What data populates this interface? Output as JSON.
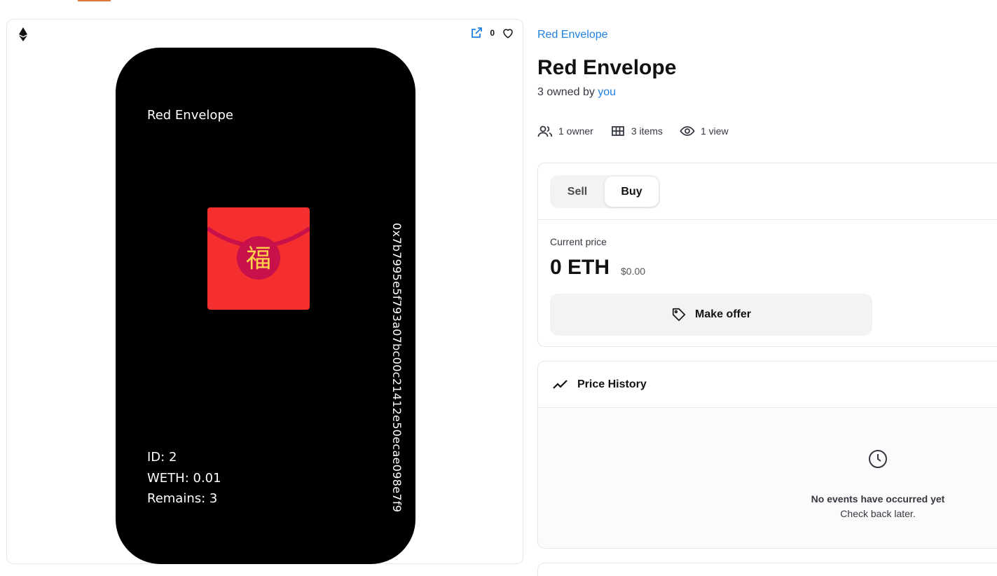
{
  "media": {
    "favorite_count": "0",
    "nft": {
      "title": "Red Envelope",
      "character": "福",
      "id_line": "ID: 2",
      "weth_line": "WETH: 0.01",
      "remains_line": "Remains: 3",
      "contract_address": "0x7b7995e5f793a07bc00c21412e50ecae098e7f9"
    }
  },
  "item": {
    "collection_name": "Red Envelope",
    "title": "Red Envelope",
    "owned_prefix": "3 owned by ",
    "owned_by": "you"
  },
  "stats": {
    "owners": "1 owner",
    "items": "3 items",
    "views": "1 view"
  },
  "trade": {
    "tabs": [
      "Sell",
      "Buy"
    ],
    "active_tab": "Buy",
    "current_price_label": "Current price",
    "price": "0 ETH",
    "price_usd": "$0.00",
    "offer_button_label": "Make offer"
  },
  "price_history": {
    "title": "Price History",
    "empty_title": "No events have occurred yet",
    "empty_subtitle": "Check back later."
  },
  "icons": {
    "chain": "ethereum-icon",
    "external": "external-link-icon",
    "favorite": "heart-icon",
    "owners": "users-icon",
    "items": "grid-icon",
    "views": "eye-icon",
    "offer": "tag-icon",
    "history": "trending-line-icon",
    "empty": "clock-icon"
  },
  "colors": {
    "link": "#2081e2",
    "envelope_red": "#f52f2f",
    "envelope_seal": "#c8104a",
    "character_gold": "#ffd24a"
  }
}
